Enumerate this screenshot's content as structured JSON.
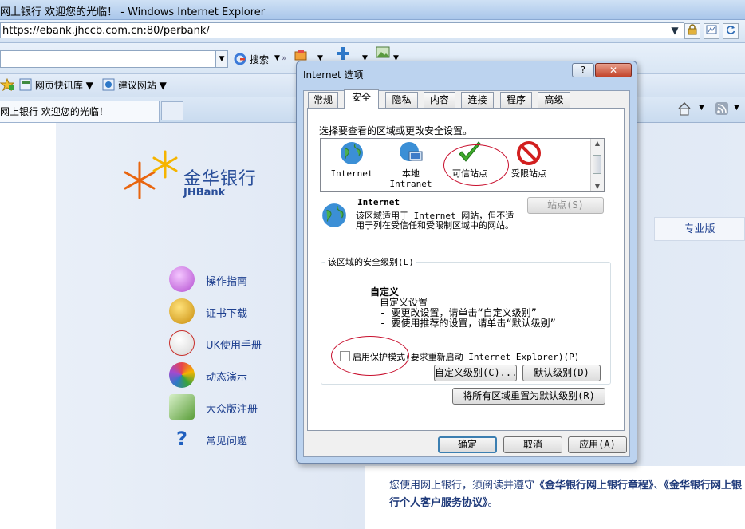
{
  "browser": {
    "title": "网上银行 欢迎您的光临！ - Windows Internet Explorer",
    "url": "https://ebank.jhccb.com.cn:80/perbank/",
    "search_label": "搜索",
    "favorites": [
      {
        "label": "网页快讯库",
        "icon": "web-slice-icon"
      },
      {
        "label": "建议网站",
        "icon": "suggested-sites-icon"
      }
    ],
    "tab_title": "网上银行 欢迎您的光临！"
  },
  "page": {
    "bank_name": "金华银行",
    "bank_name_en": "JHBank",
    "menu": [
      {
        "label": "操作指南",
        "icon": "guide-icon",
        "color": "#c35ad8"
      },
      {
        "label": "证书下载",
        "icon": "certificate-download-icon",
        "color": "#d9a21a"
      },
      {
        "label": "UK使用手册",
        "icon": "manual-icon",
        "color": "#c9302c"
      },
      {
        "label": "动态演示",
        "icon": "demo-icon",
        "color": "#e8454a"
      },
      {
        "label": "大众版注册",
        "icon": "register-icon",
        "color": "#5b9e3a"
      },
      {
        "label": "常见问题",
        "icon": "faq-icon",
        "color": "#1f5fbf"
      }
    ],
    "pro_tab": "专业版",
    "notice_prefix": "您使用网上银行，须阅读并遵守",
    "notice_link1": "《金华银行网上银行章程》",
    "notice_sep": "、",
    "notice_link2": "《金华银行网上银行个人客户服务协议》",
    "notice_suffix": "。"
  },
  "dialog": {
    "title": "Internet 选项",
    "help": "?",
    "close": "✕",
    "tabs": [
      "常规",
      "安全",
      "隐私",
      "内容",
      "连接",
      "程序",
      "高级"
    ],
    "active_tab": 1,
    "zone_prompt": "选择要查看的区域或更改安全设置。",
    "zones": [
      {
        "label1": "Internet",
        "label2": "",
        "icon": "internet-globe-icon"
      },
      {
        "label1": "本地",
        "label2": "Intranet",
        "icon": "local-intranet-icon"
      },
      {
        "label1": "可信站点",
        "label2": "",
        "icon": "trusted-sites-check-icon"
      },
      {
        "label1": "受限站点",
        "label2": "",
        "icon": "restricted-sites-icon"
      }
    ],
    "zone_desc_title": "Internet",
    "zone_desc": "该区域适用于 Internet 网站，但不适用于列在受信任和受限制区域中的网站。",
    "sites_button": "站点(S)",
    "security_level_label": "该区域的安全级别(L)",
    "level_name": "自定义",
    "level_desc": "自定义设置\n- 要更改设置，请单击“自定义级别”\n- 要使用推荐的设置，请单击“默认级别”",
    "protected_mode_label": "启用保护模式(要求重新启动 Internet Explorer)(P)",
    "protected_mode_checked": false,
    "custom_level_button": "自定义级别(C)...",
    "default_level_button": "默认级别(D)",
    "reset_all_button": "将所有区域重置为默认级别(R)",
    "ok_button": "确定",
    "cancel_button": "取消",
    "apply_button": "应用(A)"
  }
}
